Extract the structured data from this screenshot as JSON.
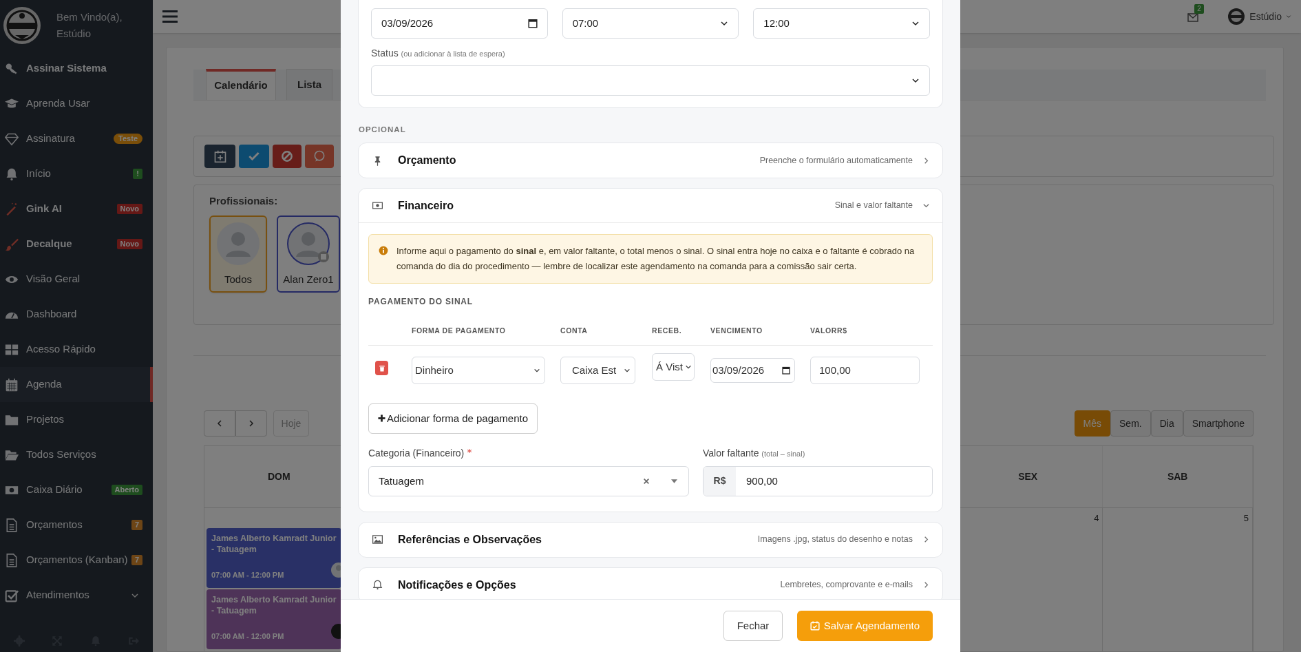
{
  "sidebar": {
    "greeting": "Bem Vindo(a),",
    "user": "Estúdio",
    "items": [
      {
        "label": "Assinar Sistema",
        "bold": true,
        "selected": false,
        "kind": "link"
      },
      {
        "label": "Aprenda Usar",
        "bold": false,
        "selected": false,
        "kind": "link"
      },
      {
        "label": "Assinatura",
        "bold": false,
        "selected": false,
        "kind": "link",
        "badge": {
          "text": "Teste",
          "color": "#7a4e09",
          "pill": true
        }
      },
      {
        "label": "Início",
        "bold": false,
        "selected": false,
        "kind": "link",
        "badge": {
          "text": "!",
          "color": "#1e4d1e",
          "pill": false
        }
      },
      {
        "label": "Gink AI",
        "bold": true,
        "selected": false,
        "kind": "link",
        "badge": {
          "text": "Novo",
          "color": "#651816",
          "pill": false
        }
      },
      {
        "label": "Decalque",
        "bold": true,
        "selected": false,
        "kind": "link",
        "badge": {
          "text": "Novo",
          "color": "#651816",
          "pill": false
        }
      },
      {
        "label": "Visão Geral",
        "bold": false,
        "selected": false,
        "kind": "link"
      },
      {
        "label": "Dashboard",
        "bold": false,
        "selected": false,
        "kind": "link"
      },
      {
        "label": "Acesso Rápido",
        "bold": false,
        "selected": false,
        "kind": "link"
      },
      {
        "label": "Agenda",
        "bold": false,
        "selected": true,
        "kind": "link"
      },
      {
        "label": "Projetos",
        "bold": false,
        "selected": false,
        "kind": "link"
      },
      {
        "label": "Todos Serviços",
        "bold": false,
        "selected": false,
        "kind": "link"
      },
      {
        "label": "Caixa Diário",
        "bold": false,
        "selected": false,
        "kind": "link",
        "badge": {
          "text": "Aberto",
          "color": "#1e4d1e",
          "pill": false
        }
      },
      {
        "label": "Orçamentos",
        "bold": false,
        "selected": false,
        "kind": "link",
        "badge": {
          "text": "7",
          "color": "#6d4516",
          "pill": false
        }
      },
      {
        "label": "Orçamentos (Kanban)",
        "bold": false,
        "selected": false,
        "kind": "link",
        "badge": {
          "text": "7",
          "color": "#6d4516",
          "pill": false
        }
      },
      {
        "label": "Atendimentos",
        "bold": false,
        "selected": false,
        "kind": "group"
      }
    ]
  },
  "navbar": {
    "mail_count": "2",
    "user": "Estúdio"
  },
  "tabs": [
    {
      "label": "Calendário",
      "selected": true
    },
    {
      "label": "Lista",
      "selected": false
    }
  ],
  "professionals": {
    "title": "Profissionais:",
    "items": [
      {
        "name": "Todos",
        "selected": true
      },
      {
        "name": "Alan Zero1",
        "selected": false
      }
    ]
  },
  "calendar": {
    "nav": {
      "today": "Hoje"
    },
    "views": [
      {
        "label": "Mês",
        "selected": true
      },
      {
        "label": "Sem.",
        "selected": false
      },
      {
        "label": "Dia",
        "selected": false
      },
      {
        "label": "Smartphone",
        "selected": false
      }
    ],
    "day_headers": [
      {
        "label": "DOM"
      },
      {
        "label": "SEX"
      },
      {
        "label": "SAB"
      }
    ],
    "day_numbers": [
      "4",
      "5"
    ],
    "events": [
      {
        "title": "James Alberto Kamradt Junior - Tatuagem",
        "time": "07:00 AM - 12:00 PM",
        "color": "#293066"
      },
      {
        "title": "James Alberto Kamradt Junior - Tatuagem",
        "time": "07:00 AM - 12:00 PM",
        "color": "#4e3358"
      }
    ]
  },
  "modal": {
    "schedule_fields": [
      {
        "kind": "date",
        "value": "03/09/2026"
      },
      {
        "kind": "select",
        "value": "07:00"
      },
      {
        "kind": "select",
        "value": "12:00"
      }
    ],
    "status": {
      "label": "Status",
      "hint": "(ou adicionar à lista de espera)"
    },
    "optional_label": "OPCIONAL",
    "sections": [
      {
        "title": "Orçamento",
        "subtitle": "Preenche o formulário automaticamente",
        "expanded": false
      },
      {
        "title": "Financeiro",
        "subtitle": "Sinal e valor faltante",
        "expanded": true
      },
      {
        "title": "Referências e Observações",
        "subtitle": "Imagens .jpg, status do desenho e notas",
        "expanded": false
      },
      {
        "title": "Notificações e Opções",
        "subtitle": "Lembretes, comprovante e e-mails",
        "expanded": false
      }
    ],
    "financeiro": {
      "alert": "Informe aqui o pagamento do **sinal** e, em valor faltante, o total menos o sinal. O sinal entra hoje no caixa e o faltante é cobrado na comanda do dia do procedimento — lembre de localizar este agendamento na comanda para a comissão sair certa.",
      "payment_title": "PAGAMENTO DO SINAL",
      "columns": [
        "FORMA DE PAGAMENTO",
        "CONTA",
        "RECEB.",
        "VENCIMENTO",
        "VALORR$"
      ],
      "rows": [
        {
          "method": "Dinheiro",
          "account": "Caixa Est",
          "receipt": "Á Vist",
          "due": "03/09/2026",
          "amount": "100,00"
        }
      ],
      "add_button": "Adicionar forma de pagamento",
      "category": {
        "label": "Categoria (Financeiro)",
        "required": true,
        "value": "Tatuagem"
      },
      "remaining": {
        "label": "Valor faltante",
        "hint": "(total – sinal)",
        "prefix": "R$",
        "value": "900,00"
      }
    },
    "buttons": [
      {
        "label": "Fechar",
        "kind": "secondary"
      },
      {
        "label": "Salvar Agendamento",
        "kind": "primary"
      }
    ]
  }
}
